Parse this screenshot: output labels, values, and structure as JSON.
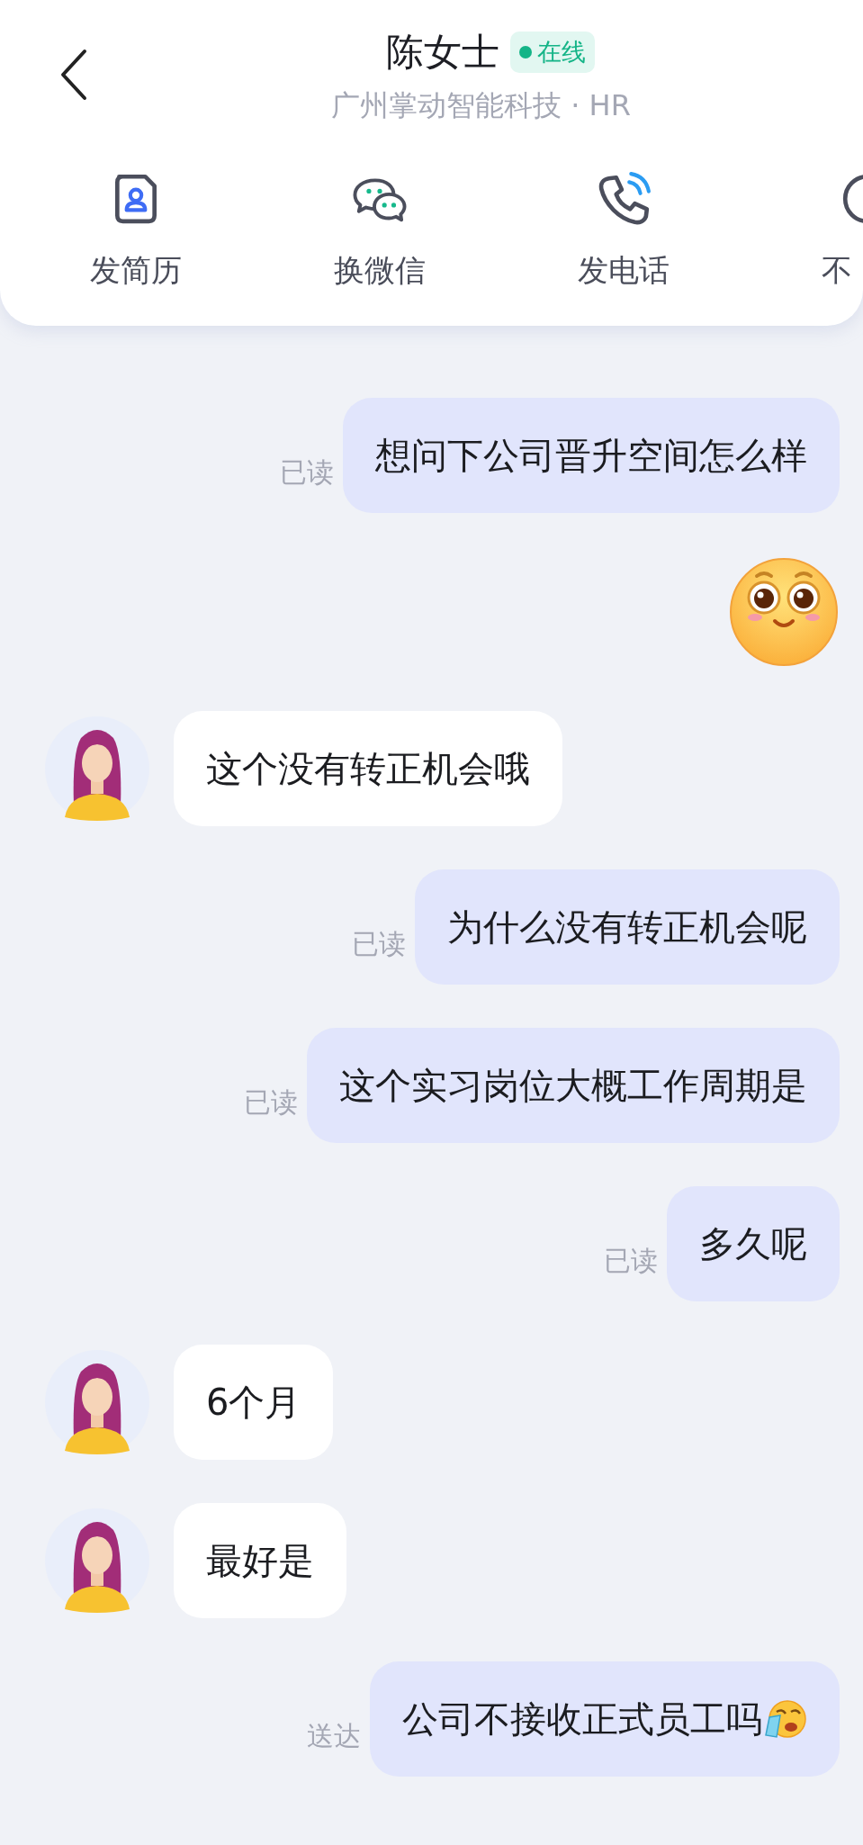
{
  "contact": {
    "name": "陈女士",
    "status": "在线",
    "subtitle": "广州掌动智能科技 · HR"
  },
  "actions": [
    {
      "label": "发简历"
    },
    {
      "label": "换微信"
    },
    {
      "label": "发电话"
    },
    {
      "label": "不"
    }
  ],
  "messages": [
    {
      "kind": "sent",
      "text": "想问下公司晋升空间怎么样",
      "status": "已读"
    },
    {
      "kind": "sticker"
    },
    {
      "kind": "received",
      "text": "这个没有转正机会哦"
    },
    {
      "kind": "sent",
      "text": "为什么没有转正机会呢",
      "status": "已读"
    },
    {
      "kind": "sent",
      "text": "这个实习岗位大概工作周期是",
      "status": "已读"
    },
    {
      "kind": "sent",
      "text": "多久呢",
      "status": "已读"
    },
    {
      "kind": "received",
      "text": "6个月"
    },
    {
      "kind": "received",
      "text": "最好是"
    },
    {
      "kind": "sent_crying",
      "text": "公司不接收正式员工吗",
      "status": "送达"
    }
  ]
}
